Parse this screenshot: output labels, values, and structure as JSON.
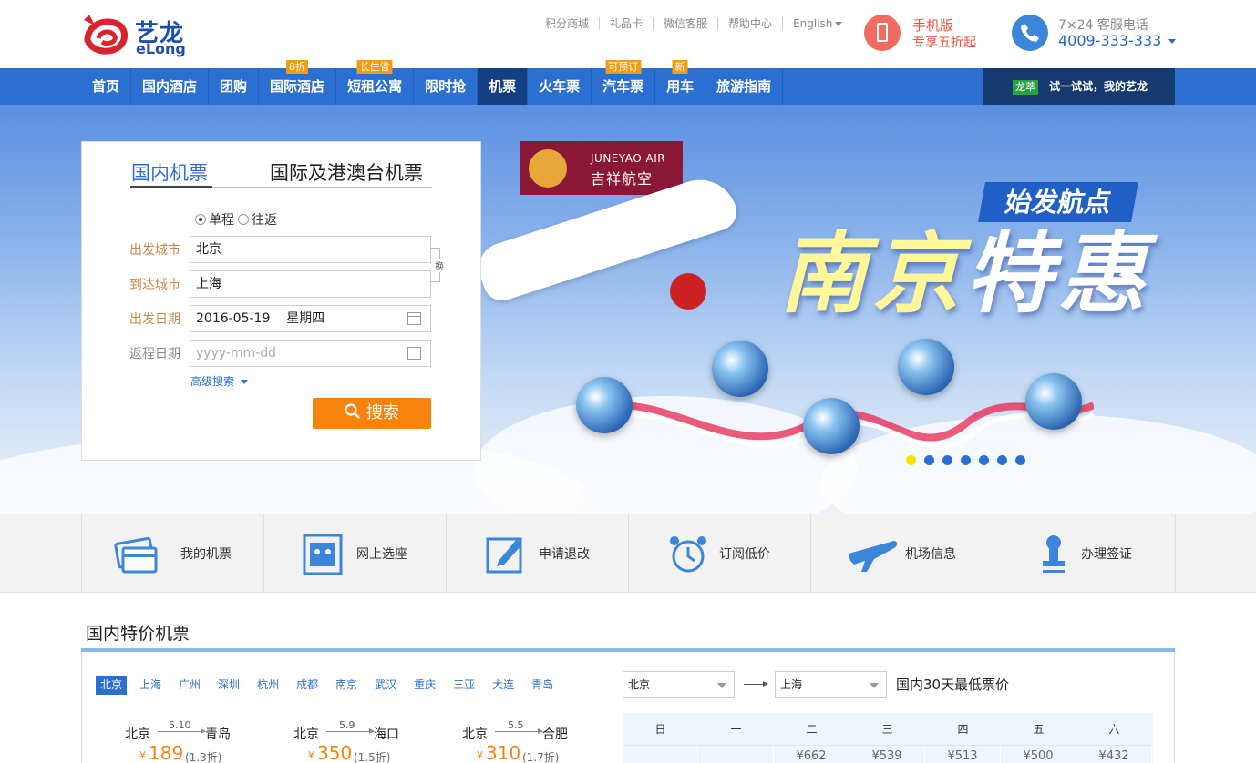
{
  "header": {
    "logo_cn": "艺龙",
    "logo_en": "eLong",
    "links": [
      "积分商城",
      "礼品卡",
      "微信客服",
      "帮助中心",
      "English"
    ],
    "mobile_line1": "手机版",
    "mobile_line2": "专享五折起",
    "hotline_label": "7×24 客服电话",
    "hotline_number": "4009-333-333"
  },
  "nav": {
    "items": [
      {
        "label": "首页",
        "badge": ""
      },
      {
        "label": "国内酒店",
        "badge": ""
      },
      {
        "label": "团购",
        "badge": ""
      },
      {
        "label": "国际酒店",
        "badge": "8折"
      },
      {
        "label": "短租公寓",
        "badge": "长住省"
      },
      {
        "label": "限时抢",
        "badge": ""
      },
      {
        "label": "机票",
        "badge": ""
      },
      {
        "label": "火车票",
        "badge": ""
      },
      {
        "label": "汽车票",
        "badge": "可预订"
      },
      {
        "label": "用车",
        "badge": "新"
      },
      {
        "label": "旅游指南",
        "badge": ""
      }
    ],
    "active": "机票",
    "try_tag": "龙萃",
    "try_text": "试一试试，我的艺龙"
  },
  "search": {
    "tab_domestic": "国内机票",
    "tab_international": "国际及港澳台机票",
    "trip_one_way": "单程",
    "trip_round": "往返",
    "from_label": "出发城市",
    "from_value": "北京",
    "to_label": "到达城市",
    "to_value": "上海",
    "depart_label": "出发日期",
    "depart_value": "2016-05-19    星期四",
    "return_label": "返程日期",
    "return_placeholder": "yyyy-mm-dd",
    "swap_label": "换",
    "advanced": "高级搜索",
    "button": "搜索"
  },
  "banner": {
    "airline_en": "JUNEYAO AIR",
    "airline_cn": "吉祥航空",
    "tag": "始发航点",
    "headline_a": "南京",
    "headline_b": "特惠",
    "slide_count": 7,
    "active_slide": 1
  },
  "services": [
    {
      "label": "我的机票",
      "icon": "ticket-card-icon"
    },
    {
      "label": "网上选座",
      "icon": "seat-select-icon"
    },
    {
      "label": "申请退改",
      "icon": "edit-refund-icon"
    },
    {
      "label": "订阅低价",
      "icon": "alarm-clock-icon"
    },
    {
      "label": "机场信息",
      "icon": "airplane-icon"
    },
    {
      "label": "办理签证",
      "icon": "stamp-icon"
    }
  ],
  "deals": {
    "title": "国内特价机票",
    "cities": [
      "北京",
      "上海",
      "广州",
      "深圳",
      "杭州",
      "成都",
      "南京",
      "武汉",
      "重庆",
      "三亚",
      "大连",
      "青岛"
    ],
    "active_city": "北京",
    "fares": [
      {
        "from": "北京",
        "date": "5.10",
        "to": "青岛",
        "currency": "¥",
        "price": "189",
        "discount": "(1.3折)"
      },
      {
        "from": "北京",
        "date": "5.9",
        "to": "海口",
        "currency": "¥",
        "price": "350",
        "discount": "(1.5折)"
      },
      {
        "from": "北京",
        "date": "5.5",
        "to": "合肥",
        "currency": "¥",
        "price": "310",
        "discount": "(1.7折)"
      }
    ],
    "route_from": "北京",
    "route_to": "上海",
    "low_title": "国内30天最低票价",
    "weekdays": [
      "日",
      "一",
      "二",
      "三",
      "四",
      "五",
      "六"
    ],
    "first_row_prices": [
      "",
      "",
      "¥662",
      "¥539",
      "¥513",
      "¥500",
      "¥432"
    ]
  }
}
